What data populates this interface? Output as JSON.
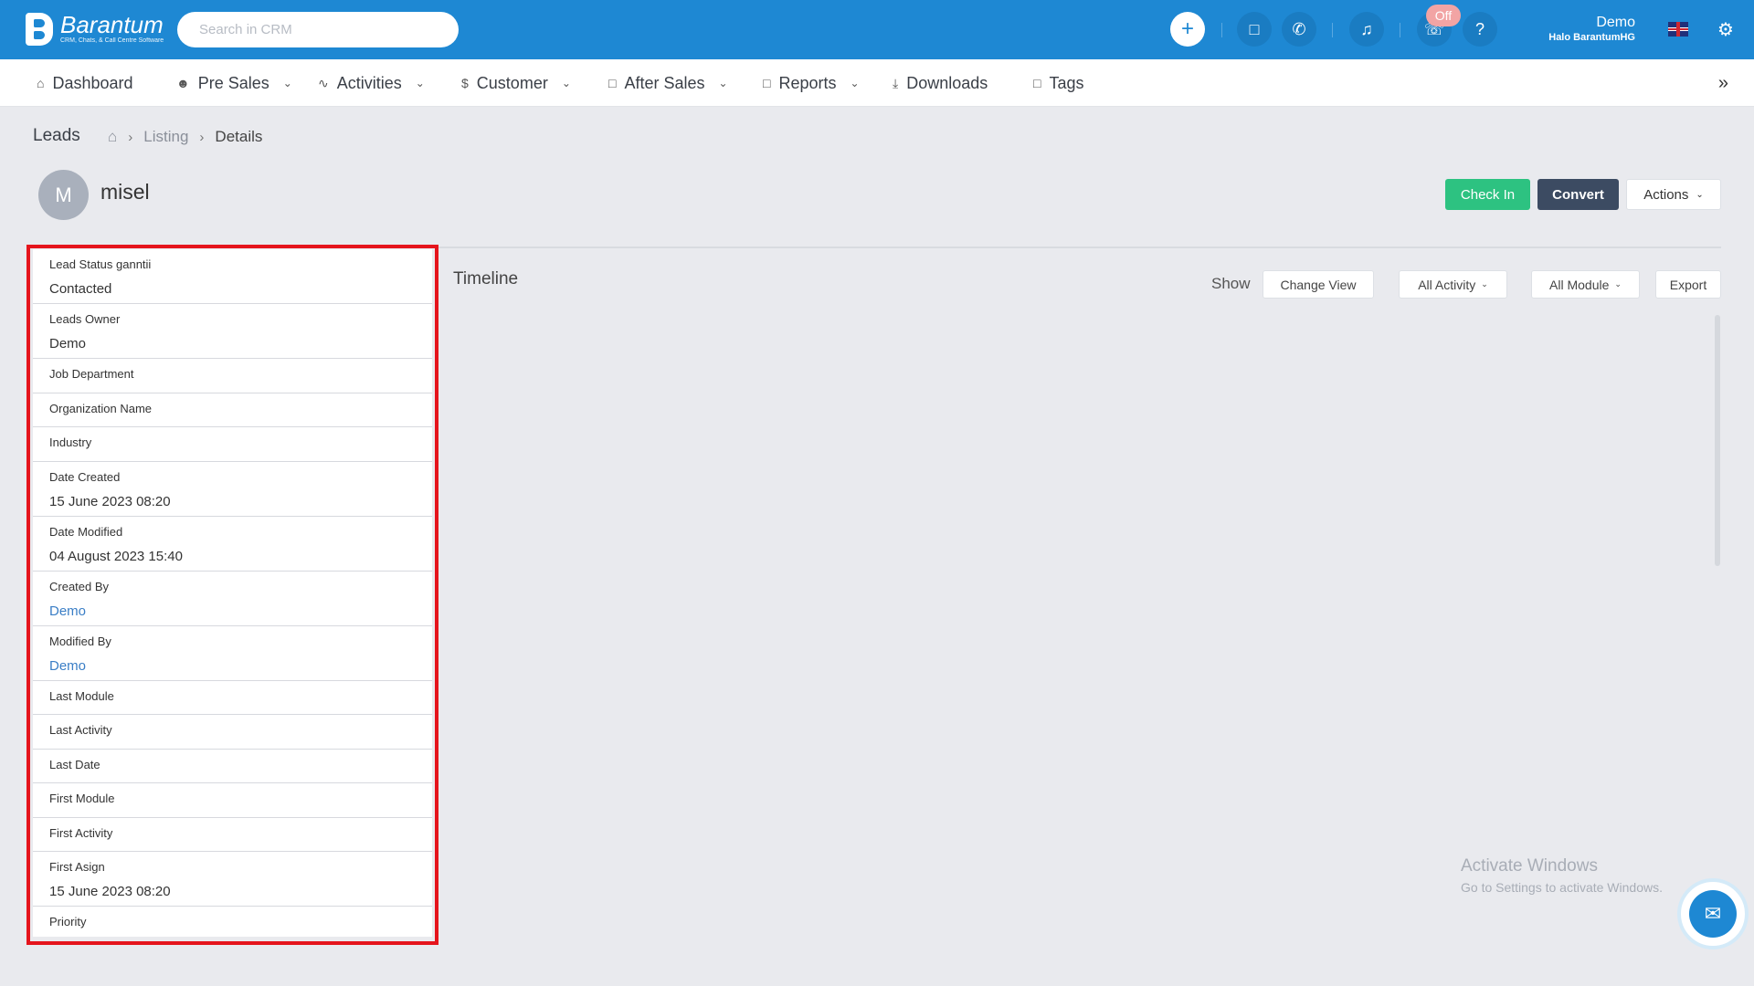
{
  "app": {
    "logo_name": "Barantum",
    "logo_tagline": "CRM, Chats, & Call Centre Software",
    "search_placeholder": "Search in CRM",
    "off_badge": "Off",
    "user_name": "Demo",
    "user_org": "Halo BarantumHG"
  },
  "nav": {
    "items": [
      {
        "label": "Dashboard"
      },
      {
        "label": "Pre Sales"
      },
      {
        "label": "Activities"
      },
      {
        "label": "Customer"
      },
      {
        "label": "After Sales"
      },
      {
        "label": "Reports"
      },
      {
        "label": "Downloads"
      },
      {
        "label": "Tags"
      }
    ]
  },
  "breadcrumb": {
    "title": "Leads",
    "listing": "Listing",
    "current": "Details"
  },
  "record": {
    "avatar_initial": "M",
    "name": "misel",
    "checkin_label": "Check In",
    "convert_label": "Convert",
    "actions_label": "Actions"
  },
  "fields": [
    {
      "label": "Lead Status ganntii",
      "value": "Contacted"
    },
    {
      "label": "Leads Owner",
      "value": "Demo"
    },
    {
      "label": "Job Department",
      "value": ""
    },
    {
      "label": "Organization Name",
      "value": ""
    },
    {
      "label": "Industry",
      "value": ""
    },
    {
      "label": "Date Created",
      "value": "15 June 2023 08:20"
    },
    {
      "label": "Date Modified",
      "value": "04 August 2023 15:40"
    },
    {
      "label": "Created By",
      "value": "Demo"
    },
    {
      "label": "Modified By",
      "value": "Demo"
    },
    {
      "label": "Last Module",
      "value": ""
    },
    {
      "label": "Last Activity",
      "value": ""
    },
    {
      "label": "Last Date",
      "value": ""
    },
    {
      "label": "First Module",
      "value": ""
    },
    {
      "label": "First Activity",
      "value": ""
    },
    {
      "label": "First Asign",
      "value": "15 June 2023 08:20"
    },
    {
      "label": "Priority",
      "value": ""
    }
  ],
  "timeline": {
    "title": "Timeline",
    "show_label": "Show",
    "change_view": "Change View",
    "all_activity": "All Activity",
    "all_module": "All Module",
    "export": "Export"
  },
  "watermark": {
    "line1": "Activate Windows",
    "line2": "Go to Settings to activate Windows."
  }
}
